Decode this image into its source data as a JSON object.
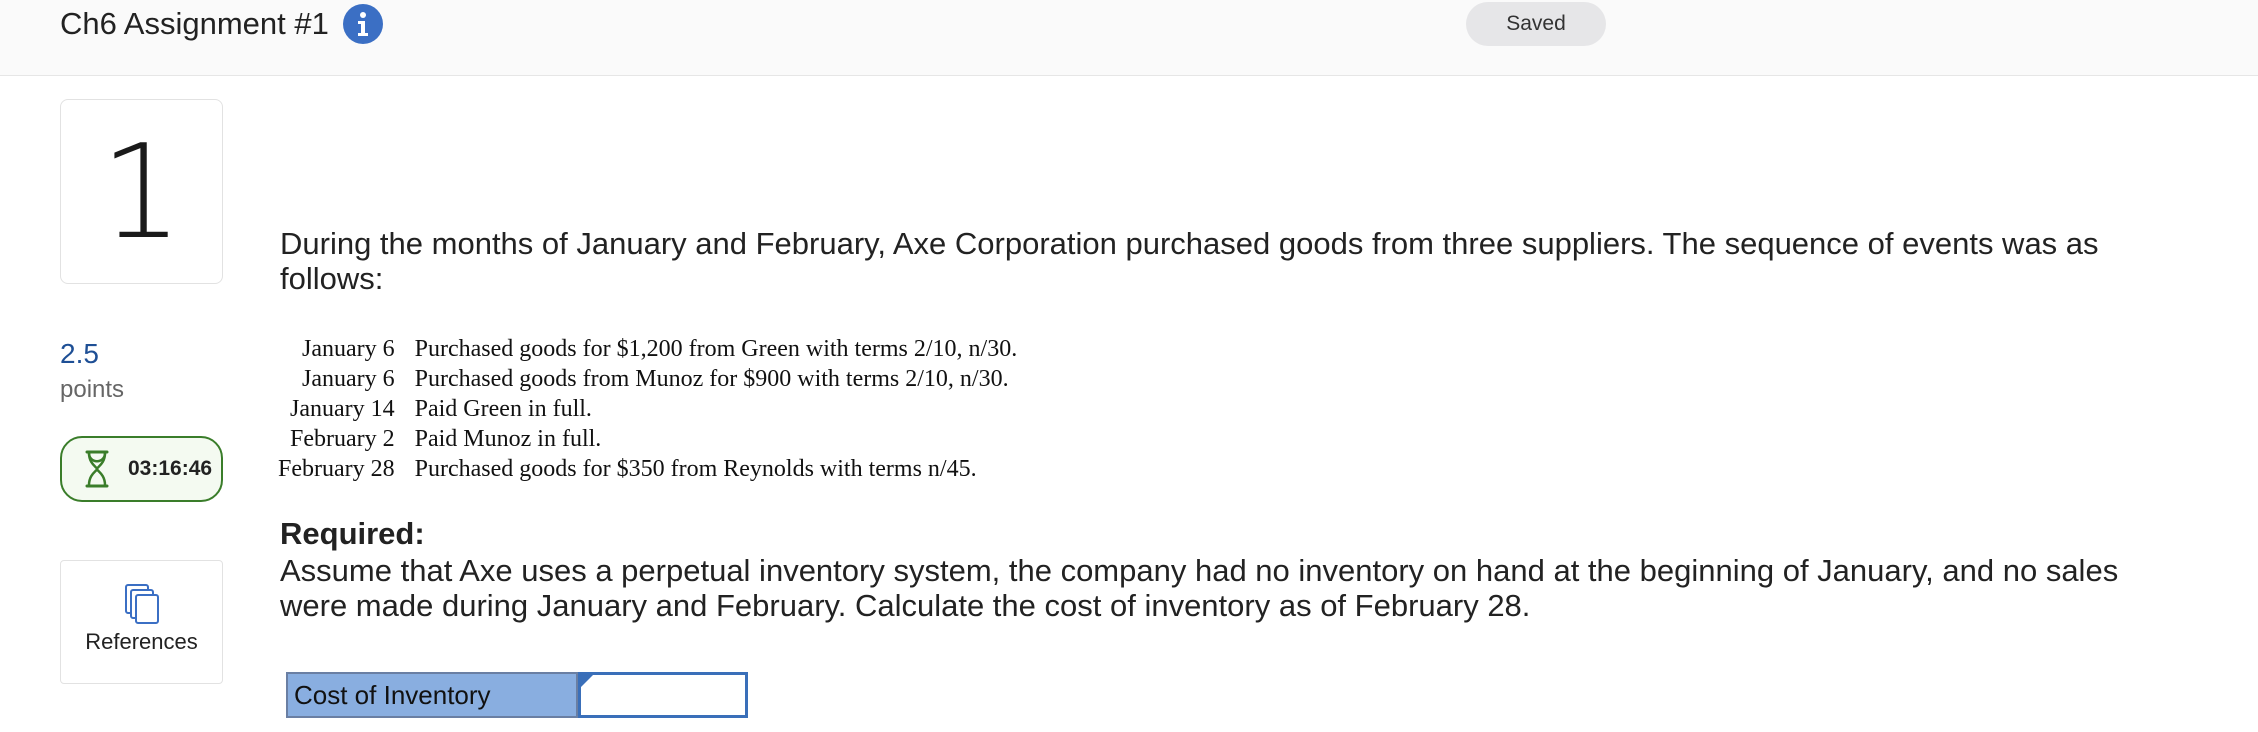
{
  "header": {
    "title": "Ch6 Assignment #1",
    "status": "Saved"
  },
  "sidebar": {
    "question_number": "1",
    "points_value": "2.5",
    "points_label": "points",
    "timer": "03:16:46",
    "references_label": "References"
  },
  "question": {
    "intro": "During the months of January and February, Axe Corporation purchased goods from three suppliers. The sequence of events was as follows:",
    "events": [
      {
        "date": "January 6",
        "description": "Purchased goods for $1,200 from Green with terms 2/10, n/30."
      },
      {
        "date": "January 6",
        "description": "Purchased goods from Munoz for $900 with terms 2/10, n/30."
      },
      {
        "date": "January 14",
        "description": "Paid Green in full."
      },
      {
        "date": "February 2",
        "description": "Paid Munoz in full."
      },
      {
        "date": "February 28",
        "description": "Purchased goods for $350 from Reynolds with terms n/45."
      }
    ],
    "required_heading": "Required:",
    "required_text": "Assume that Axe uses a perpetual inventory system, the company had no inventory on hand at the beginning of January, and no sales were made during January and February. Calculate the cost of inventory as of February 28."
  },
  "answer": {
    "label": "Cost of Inventory",
    "value": ""
  },
  "colors": {
    "info_icon": "#3b6fc4",
    "timer_border": "#3a7d2a",
    "points_blue": "#1e4f95",
    "answer_label_bg": "#89aee0",
    "input_border": "#3a6fb9"
  },
  "icons": {
    "info": "info-icon",
    "timer": "hourglass-icon",
    "references": "documents-icon"
  }
}
